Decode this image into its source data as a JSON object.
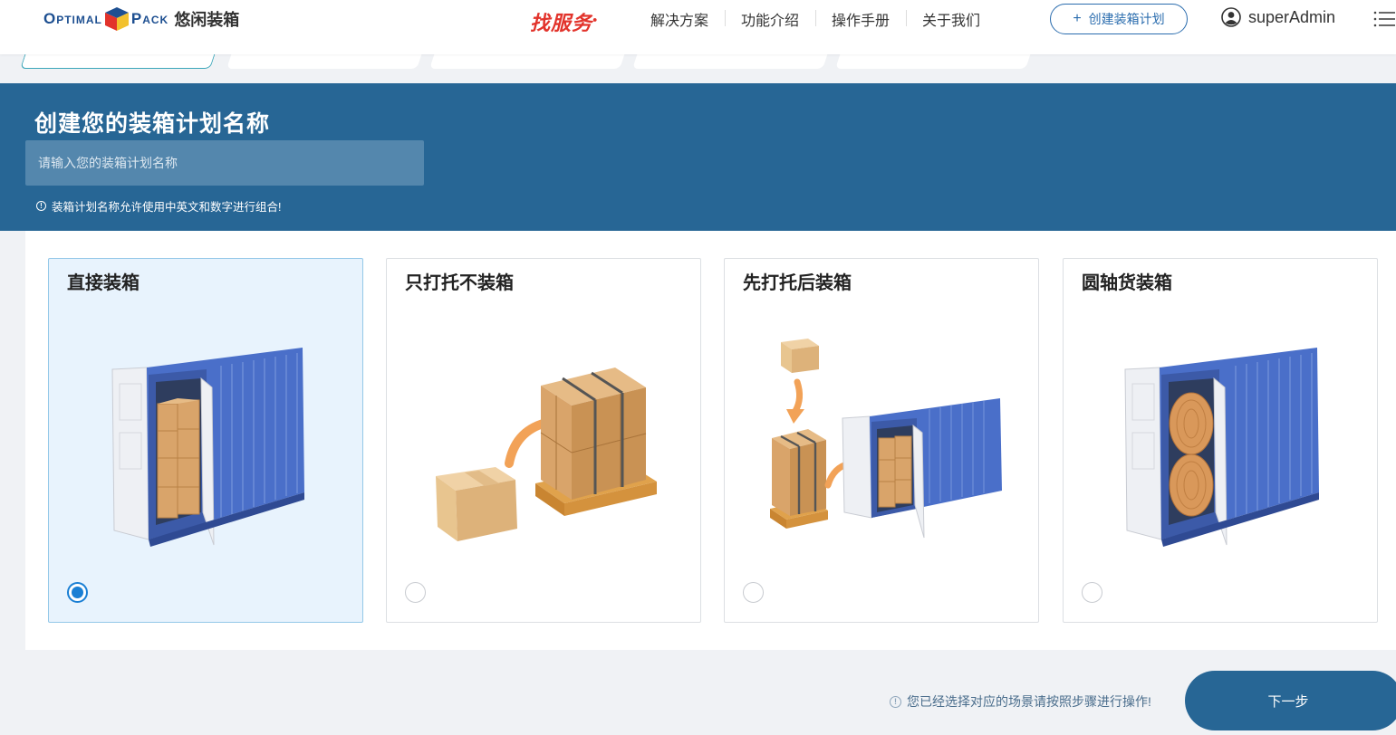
{
  "header": {
    "logo_en": "OptimalPack",
    "logo_cn": "悠闲装箱",
    "find_service": "找服务",
    "nav": [
      "解决方案",
      "功能介绍",
      "操作手册",
      "关于我们"
    ],
    "create_plan_label": "创建装箱计划",
    "username": "superAdmin"
  },
  "banner": {
    "title": "创建您的装箱计划名称",
    "input_placeholder": "请输入您的装箱计划名称",
    "input_value": "",
    "hint": "装箱计划名称允许使用中英文和数字进行组合!"
  },
  "scenarios": [
    {
      "title": "直接装箱",
      "selected": true,
      "icon": "container-with-boxes-icon"
    },
    {
      "title": "只打托不装箱",
      "selected": false,
      "icon": "pallet-boxes-icon"
    },
    {
      "title": "先打托后装箱",
      "selected": false,
      "icon": "pallet-into-container-icon"
    },
    {
      "title": "圆轴货装箱",
      "selected": false,
      "icon": "container-with-rolls-icon"
    }
  ],
  "footer": {
    "hint": "您已经选择对应的场景请按照步骤进行操作!",
    "next_label": "下一步"
  },
  "colors": {
    "primary": "#276695",
    "accent": "#2a6cae",
    "selected_card_bg": "#e8f3fd",
    "radio_checked": "#1a7fd4",
    "container_blue": "#4a6fc9",
    "box_tan": "#d9a46a"
  }
}
